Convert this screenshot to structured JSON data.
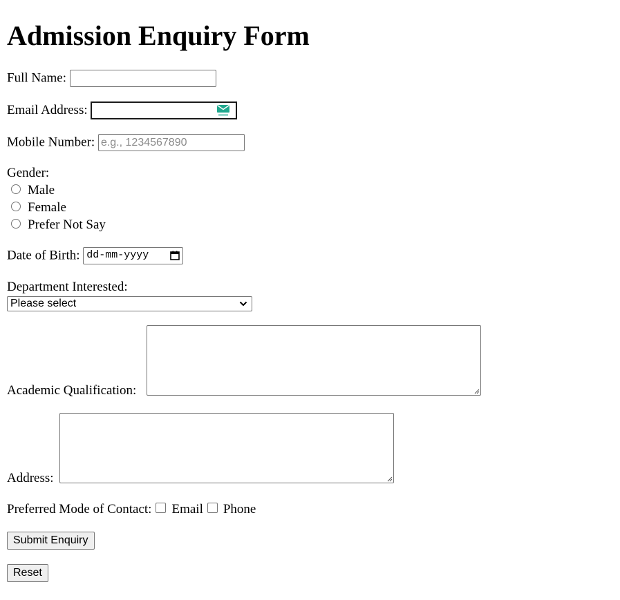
{
  "form": {
    "title": "Admission Enquiry Form",
    "full_name": {
      "label": "Full Name:",
      "value": ""
    },
    "email": {
      "label": "Email Address:",
      "value": "",
      "extension_icon": "tempmail-icon"
    },
    "mobile": {
      "label": "Mobile Number:",
      "value": "",
      "placeholder": "e.g., 1234567890"
    },
    "gender": {
      "label": "Gender:",
      "options": [
        "Male",
        "Female",
        "Prefer Not Say"
      ],
      "selected": null
    },
    "dob": {
      "label": "Date of Birth:",
      "placeholder": "dd-mm-yyyy",
      "icon": "calendar-icon"
    },
    "department": {
      "label": "Department Interested:",
      "selected": "Please select",
      "icon": "chevron-down-icon"
    },
    "qualification": {
      "label": "Academic Qualification:",
      "value": ""
    },
    "address": {
      "label": "Address:",
      "value": ""
    },
    "contact_mode": {
      "label": "Preferred Mode of Contact:",
      "options": [
        "Email",
        "Phone"
      ],
      "checked": [
        false,
        false
      ]
    },
    "submit_label": "Submit Enquiry",
    "reset_label": "Reset"
  },
  "colors": {
    "border": "#767676",
    "button_bg": "#efefef",
    "tempmail_teal": "#1fa88e"
  }
}
